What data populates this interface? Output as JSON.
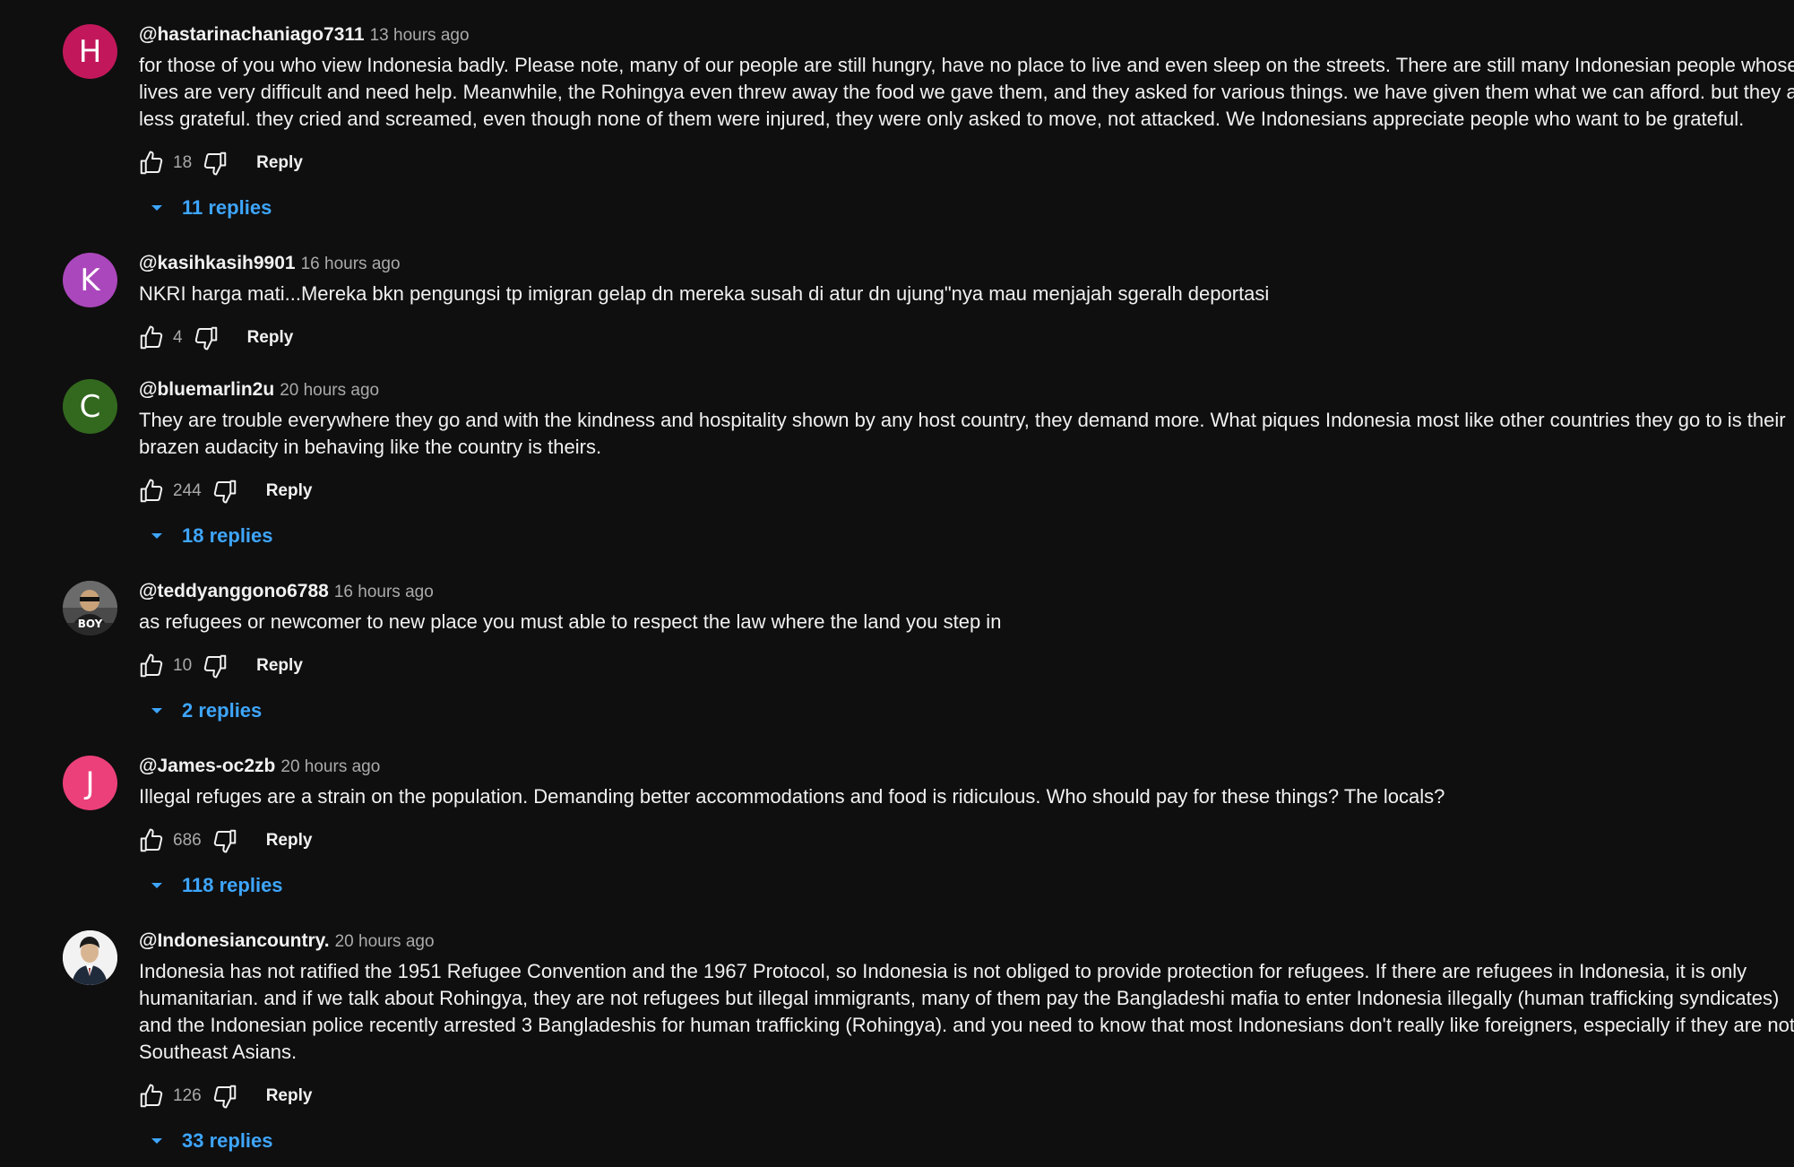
{
  "comments": [
    {
      "avatar_letter": "H",
      "avatar_color": "#c2185b",
      "handle": "@hastarinachaniago7311",
      "time": "13 hours ago",
      "lines": [
        "for those of you who view Indonesia badly. Please note, many of our people are still hungry, have no place to live and even sleep on the streets. There are still many Indonesian people whose",
        "lives are very difficult and need help. Meanwhile, the Rohingya even threw away the food we gave them, and they asked for various things. we have given them what we can afford. but they are",
        "less grateful. they cried and screamed, even though none of them were injured, they were only asked to move, not attacked. We Indonesians appreciate people who want to be grateful."
      ],
      "likes": "18",
      "reply_label": "Reply",
      "replies_label": "11 replies"
    },
    {
      "avatar_letter": "K",
      "avatar_color": "#ab47bc",
      "handle": "@kasihkasih9901",
      "time": "16 hours ago",
      "lines": [
        "NKRI harga mati...Mereka bkn pengungsi tp imigran gelap dn mereka susah di atur dn ujung\"nya mau menjajah sgeralh deportasi"
      ],
      "likes": "4",
      "reply_label": "Reply",
      "replies_label": ""
    },
    {
      "avatar_letter": "C",
      "avatar_color": "#33691e",
      "handle": "@bluemarlin2u",
      "time": "20 hours ago",
      "lines": [
        "They are trouble everywhere they go and with the kindness and hospitality shown by any host country, they demand more. What piques Indonesia most like other countries they go to is their",
        "brazen audacity in behaving like the country is theirs."
      ],
      "likes": "244",
      "reply_label": "Reply",
      "replies_label": "18 replies"
    },
    {
      "avatar_letter": "",
      "avatar_text": "BOY",
      "avatar_color": "#3a3a3a",
      "handle": "@teddyanggono6788",
      "time": "16 hours ago",
      "lines": [
        "as refugees or newcomer to new place you must able to respect the law where the land you step in"
      ],
      "likes": "10",
      "reply_label": "Reply",
      "replies_label": "2 replies"
    },
    {
      "avatar_letter": "J",
      "avatar_color": "#ec407a",
      "handle": "@James-oc2zb",
      "time": "20 hours ago",
      "lines": [
        "Illegal refuges are a strain on the population. Demanding better accommodations and food is ridiculous. Who should pay for these things? The locals?"
      ],
      "likes": "686",
      "reply_label": "Reply",
      "replies_label": "118 replies"
    },
    {
      "avatar_letter": "",
      "avatar_color": "#e8e8e8",
      "handle": "@Indonesiancountry.",
      "time": "20 hours ago",
      "lines": [
        "Indonesia has not ratified the 1951 Refugee Convention and the 1967 Protocol, so Indonesia is not obliged to provide protection for refugees. If there are refugees in Indonesia, it is only",
        "humanitarian. and if we talk about Rohingya, they are not refugees but illegal immigrants, many of them pay the Bangladeshi mafia to enter Indonesia illegally (human trafficking syndicates)",
        "and the Indonesian police recently arrested 3 Bangladeshis for human trafficking (Rohingya). and you need to know that most Indonesians don't really like foreigners, especially if they are not",
        "Southeast Asians."
      ],
      "likes": "126",
      "reply_label": "Reply",
      "replies_label": "33 replies"
    }
  ]
}
